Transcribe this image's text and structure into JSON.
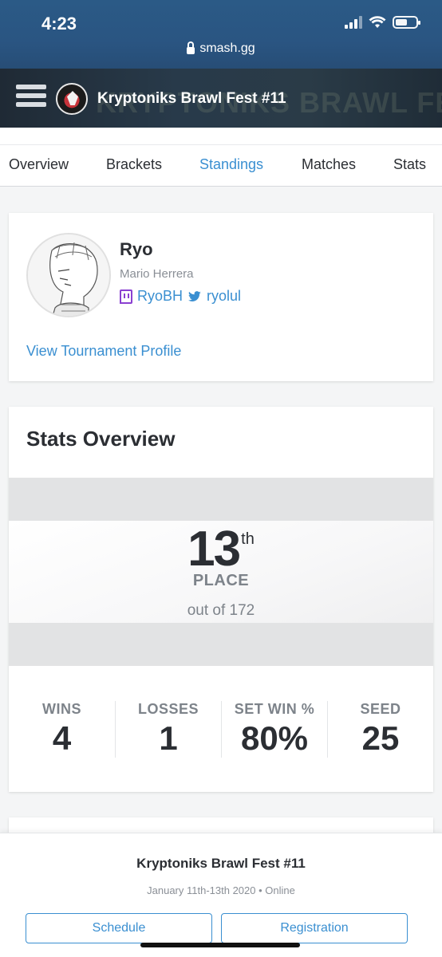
{
  "status": {
    "time": "4:23"
  },
  "browser": {
    "url": "smash.gg"
  },
  "header": {
    "title": "Kryptoniks Brawl Fest #11",
    "ghost_text": "KRYPTONIKS BRAWL FEST"
  },
  "tabs": [
    {
      "label": "Overview"
    },
    {
      "label": "Brackets"
    },
    {
      "label": "Standings",
      "active": true
    },
    {
      "label": "Matches"
    },
    {
      "label": "Stats"
    }
  ],
  "profile": {
    "tag": "Ryo",
    "real_name": "Mario Herrera",
    "twitch": "RyoBH",
    "twitter": "ryolul",
    "link_label": "View Tournament Profile"
  },
  "stats": {
    "title": "Stats Overview",
    "place": "13",
    "place_suffix": "th",
    "place_label": "PLACE",
    "out_of": "out of 172",
    "summary": [
      {
        "label": "WINS",
        "value": "4"
      },
      {
        "label": "LOSSES",
        "value": "1"
      },
      {
        "label": "SET WIN %",
        "value": "80%"
      },
      {
        "label": "SEED",
        "value": "25"
      }
    ]
  },
  "footer": {
    "title": "Kryptoniks Brawl Fest #11",
    "subtitle": "January 11th-13th 2020 • Online",
    "schedule_label": "Schedule",
    "registration_label": "Registration"
  },
  "colors": {
    "accent": "#3a8fd1",
    "twitch": "#8a3fd1",
    "header_bg": "#283a4a"
  },
  "icons": [
    "lock-icon",
    "menu-icon",
    "twitch-icon",
    "twitter-icon",
    "signal-icon",
    "wifi-icon",
    "battery-icon"
  ]
}
